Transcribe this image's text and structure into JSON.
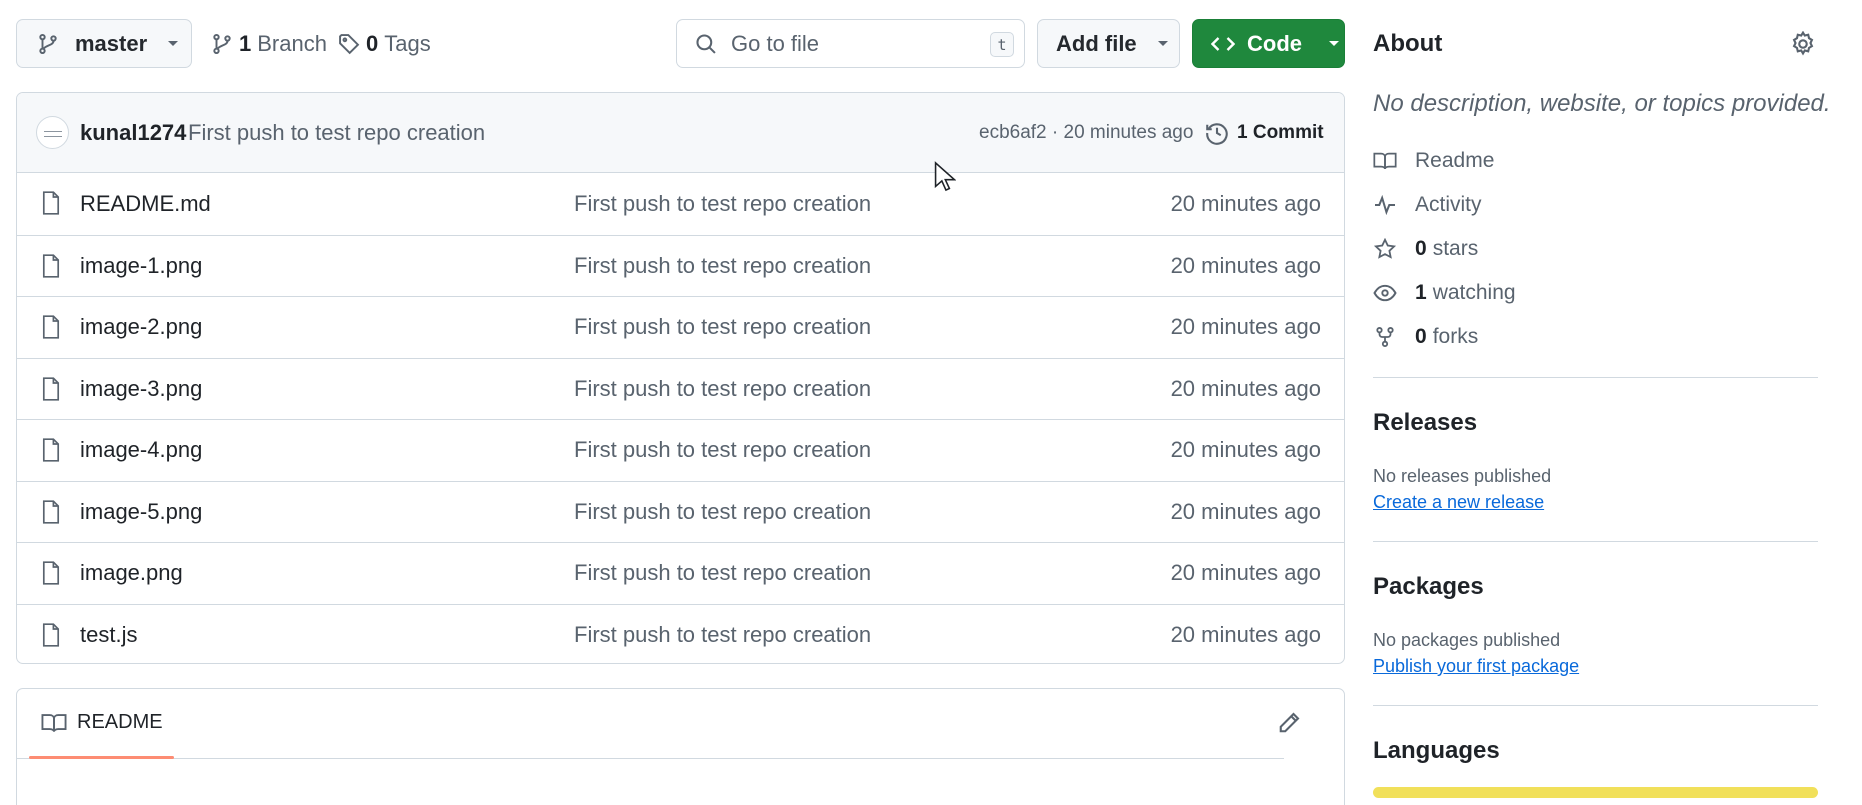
{
  "toolbar": {
    "branch": "master",
    "branches_count": "1",
    "branches_label": "Branch",
    "tags_count": "0",
    "tags_label": "Tags",
    "search_placeholder": "Go to file",
    "search_shortcut": "t",
    "add_file_label": "Add file",
    "code_label": "Code"
  },
  "commit": {
    "author": "kunal1274",
    "message": "First push to test repo creation",
    "meta": "ecb6af2 · 20 minutes ago",
    "count_label": "1 Commit"
  },
  "files": [
    {
      "name": "README.md",
      "message": "First push to test repo creation",
      "time": "20 minutes ago"
    },
    {
      "name": "image-1.png",
      "message": "First push to test repo creation",
      "time": "20 minutes ago"
    },
    {
      "name": "image-2.png",
      "message": "First push to test repo creation",
      "time": "20 minutes ago"
    },
    {
      "name": "image-3.png",
      "message": "First push to test repo creation",
      "time": "20 minutes ago"
    },
    {
      "name": "image-4.png",
      "message": "First push to test repo creation",
      "time": "20 minutes ago"
    },
    {
      "name": "image-5.png",
      "message": "First push to test repo creation",
      "time": "20 minutes ago"
    },
    {
      "name": "image.png",
      "message": "First push to test repo creation",
      "time": "20 minutes ago"
    },
    {
      "name": "test.js",
      "message": "First push to test repo creation",
      "time": "20 minutes ago"
    }
  ],
  "readme": {
    "tab_label": "README"
  },
  "sidebar": {
    "about_title": "About",
    "about_description": "No description, website, or topics provided.",
    "readme_label": "Readme",
    "activity_label": "Activity",
    "stars_count": "0",
    "stars_label": "stars",
    "watching_count": "1",
    "watching_label": "watching",
    "forks_count": "0",
    "forks_label": "forks",
    "releases_title": "Releases",
    "releases_note": "No releases published",
    "releases_link": "Create a new release",
    "packages_title": "Packages",
    "packages_note": "No packages published",
    "packages_link": "Publish your first package",
    "languages_title": "Languages"
  },
  "colors": {
    "code_button": "#1f883d",
    "link": "#0969da",
    "readme_tab_underline": "#fd8c73",
    "language_bar": "#f1e05a"
  }
}
